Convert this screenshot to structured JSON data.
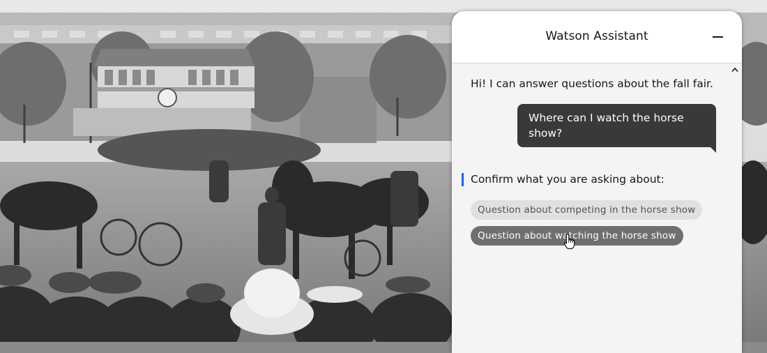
{
  "assistant": {
    "title": "Watson Assistant"
  },
  "messages": {
    "bot_greeting": "Hi! I can answer questions about the fall fair.",
    "user_question": "Where can I watch the horse show?"
  },
  "confirmation": {
    "prompt": "Confirm what you are asking about:",
    "options": [
      "Question about competing in the horse show",
      "Question about watching the horse show"
    ]
  },
  "colors": {
    "accent_bar": "#0f62fe",
    "user_bubble": "#393939",
    "option_selected": "#6f6f6f",
    "option_default": "#e0e0e0"
  },
  "icons": {
    "minimize": "minimize-icon",
    "scroll": "chevron-up-icon",
    "cursor": "hand-pointer-icon"
  }
}
